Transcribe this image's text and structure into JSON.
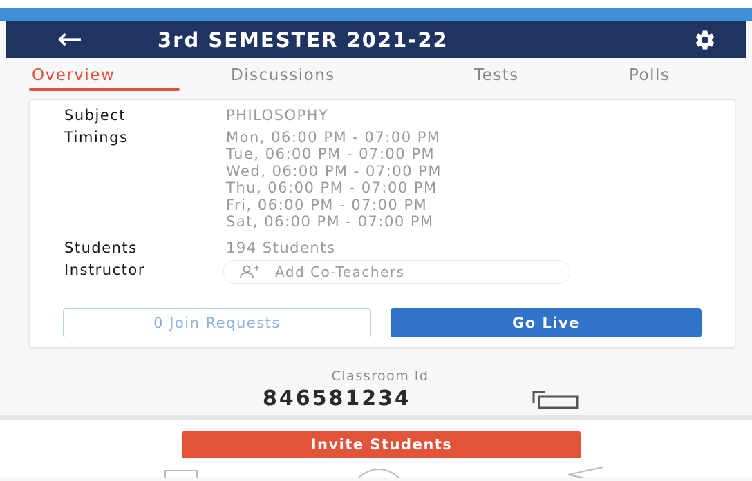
{
  "header": {
    "back_icon": "arrow-left-icon",
    "title": "3rd SEMESTER 2021-22",
    "settings_icon": "gear-icon"
  },
  "tabs": [
    {
      "label": "Overview",
      "active": true
    },
    {
      "label": "Discussions",
      "active": false
    },
    {
      "label": "Tests",
      "active": false
    },
    {
      "label": "Polls",
      "active": false
    }
  ],
  "details": {
    "subject_label": "Subject",
    "subject_value": "PHILOSOPHY",
    "timings_label": "Timings",
    "timings": [
      "Mon, 06:00 PM - 07:00 PM",
      "Tue, 06:00 PM - 07:00 PM",
      "Wed, 06:00 PM - 07:00 PM",
      "Thu, 06:00 PM - 07:00 PM",
      "Fri, 06:00 PM - 07:00 PM",
      "Sat, 06:00 PM - 07:00 PM"
    ],
    "students_label": "Students",
    "students_value": "194 Students",
    "instructor_label": "Instructor",
    "add_coteachers_label": "Add Co-Teachers",
    "add_coteachers_icon": "add-person-icon"
  },
  "actions": {
    "join_requests_label": "0 Join Requests",
    "go_live_label": "Go Live"
  },
  "classroom": {
    "id_label": "Classroom Id",
    "id_value": "846581234",
    "copy_icon": "copy-icon"
  },
  "invite_label": "Invite Students",
  "nav": {
    "recents_icon": "square-icon",
    "home_icon": "circle-icon",
    "back_icon": "triangle-back-icon"
  },
  "colors": {
    "header_bg": "#1f3461",
    "status_bar": "#3f8ed8",
    "accent_orange": "#e2543a",
    "primary_blue": "#2f74c8"
  }
}
